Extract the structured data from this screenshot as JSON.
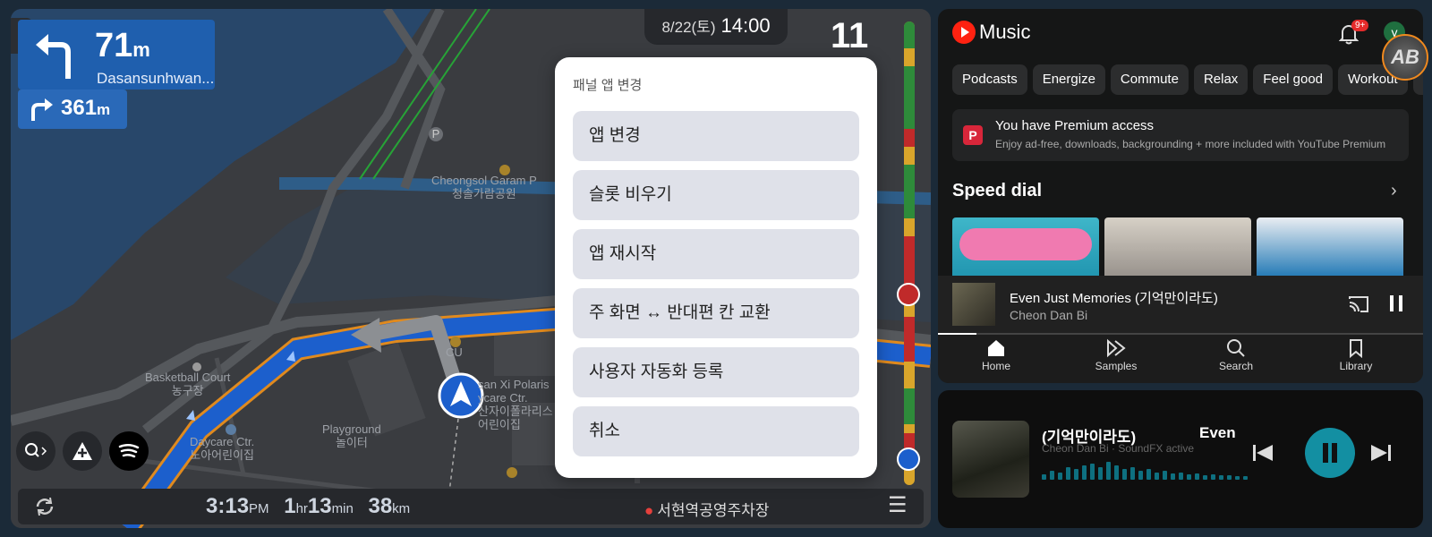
{
  "nav": {
    "side_toggle": "›",
    "turn": {
      "distance": "71",
      "unit": "m",
      "road": "Dasansunhwan..."
    },
    "next_turn": {
      "distance": "361",
      "unit": "m"
    },
    "datetime": {
      "date": "8/22(토)",
      "time": "14:00"
    },
    "speed_limit": "11",
    "map_labels": {
      "park": "Cheongsol Garam P\n청솔가람공원",
      "cu": "CU",
      "basketball": "Basketball Court\n농구장",
      "polaris": "san Xi Polaris\nycare Ctr.\n산자이폴라리스\n어린이집",
      "playground": "Playground\n놀이터",
      "daycare": "Daycare Ctr.\n노아어린이집",
      "parking": "P"
    },
    "bottom": {
      "eta_time": "3:13",
      "eta_ampm": "PM",
      "dur_h": "1",
      "dur_h_unit": "hr",
      "dur_m": "13",
      "dur_m_unit": "min",
      "dist": "38",
      "dist_unit": "km",
      "destination": "서현역공영주차장"
    },
    "colors": {
      "route": "#1c5fcc",
      "route_outline": "#e08a1e",
      "traffic_red": "#c02a2a",
      "traffic_green": "#2e8b3a",
      "traffic_yellow": "#d9a52b"
    }
  },
  "dialog": {
    "title": "패널 앱 변경",
    "options": [
      "앱 변경",
      "슬롯 비우기",
      "앱 재시작",
      "주 화면 ↔ 반대편 칸 교환",
      "사용자 자동화 등록",
      "취소"
    ]
  },
  "music": {
    "brand": "Music",
    "notification_count": "9+",
    "account_initial": "y",
    "chips": [
      "Podcasts",
      "Energize",
      "Commute",
      "Relax",
      "Feel good",
      "Workout",
      "Fo"
    ],
    "premium": {
      "badge": "P",
      "title": "You have Premium access",
      "subtitle": "Enjoy ad-free, downloads, backgrounding + more included with YouTube Premium"
    },
    "speed_dial": "Speed dial",
    "now_playing": {
      "title": "Even Just Memories (기억만이라도)",
      "artist": "Cheon Dan Bi",
      "progress": 0.08
    },
    "nav": [
      "Home",
      "Samples",
      "Search",
      "Library"
    ]
  },
  "mini_player": {
    "title": "(기억만이라도)",
    "title_prefix": "Even",
    "subtitle": "Cheon Dan Bi · SoundFX active"
  },
  "overlay": {
    "logo_text": "AB"
  }
}
